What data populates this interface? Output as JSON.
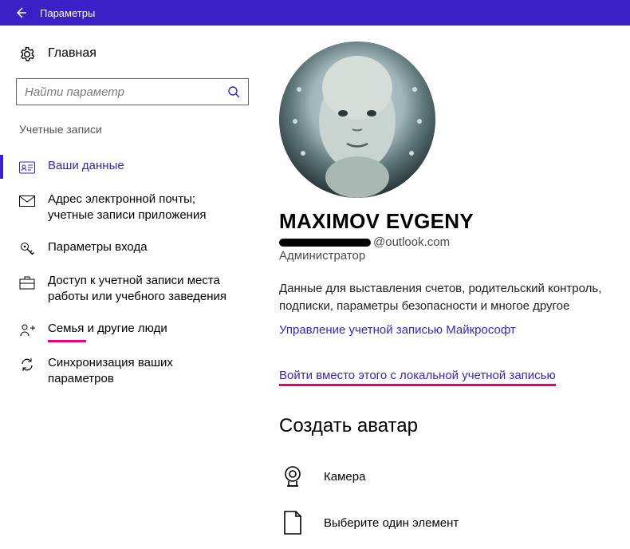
{
  "titlebar": {
    "title": "Параметры"
  },
  "sidebar": {
    "home": "Главная",
    "search_placeholder": "Найти параметр",
    "section": "Учетные записи",
    "items": [
      {
        "label": "Ваши данные"
      },
      {
        "label": "Адрес электронной почты; учетные записи приложения"
      },
      {
        "label": "Параметры входа"
      },
      {
        "label": "Доступ к учетной записи места работы или учебного заведения"
      },
      {
        "label": "Семья и другие люди"
      },
      {
        "label": "Синхронизация ваших параметров"
      }
    ]
  },
  "account": {
    "name": "MAXIMOV EVGENY",
    "email_domain": "@outlook.com",
    "role": "Администратор",
    "description": "Данные для выставления счетов, родительский контроль, подписки, параметры безопасности и многое другое",
    "manage_link": "Управление учетной записью Майкрософт",
    "local_login_link": "Войти вместо этого с локальной учетной записью"
  },
  "avatar_section": {
    "heading": "Создать аватар",
    "camera": "Камера",
    "browse": "Выберите один элемент"
  }
}
